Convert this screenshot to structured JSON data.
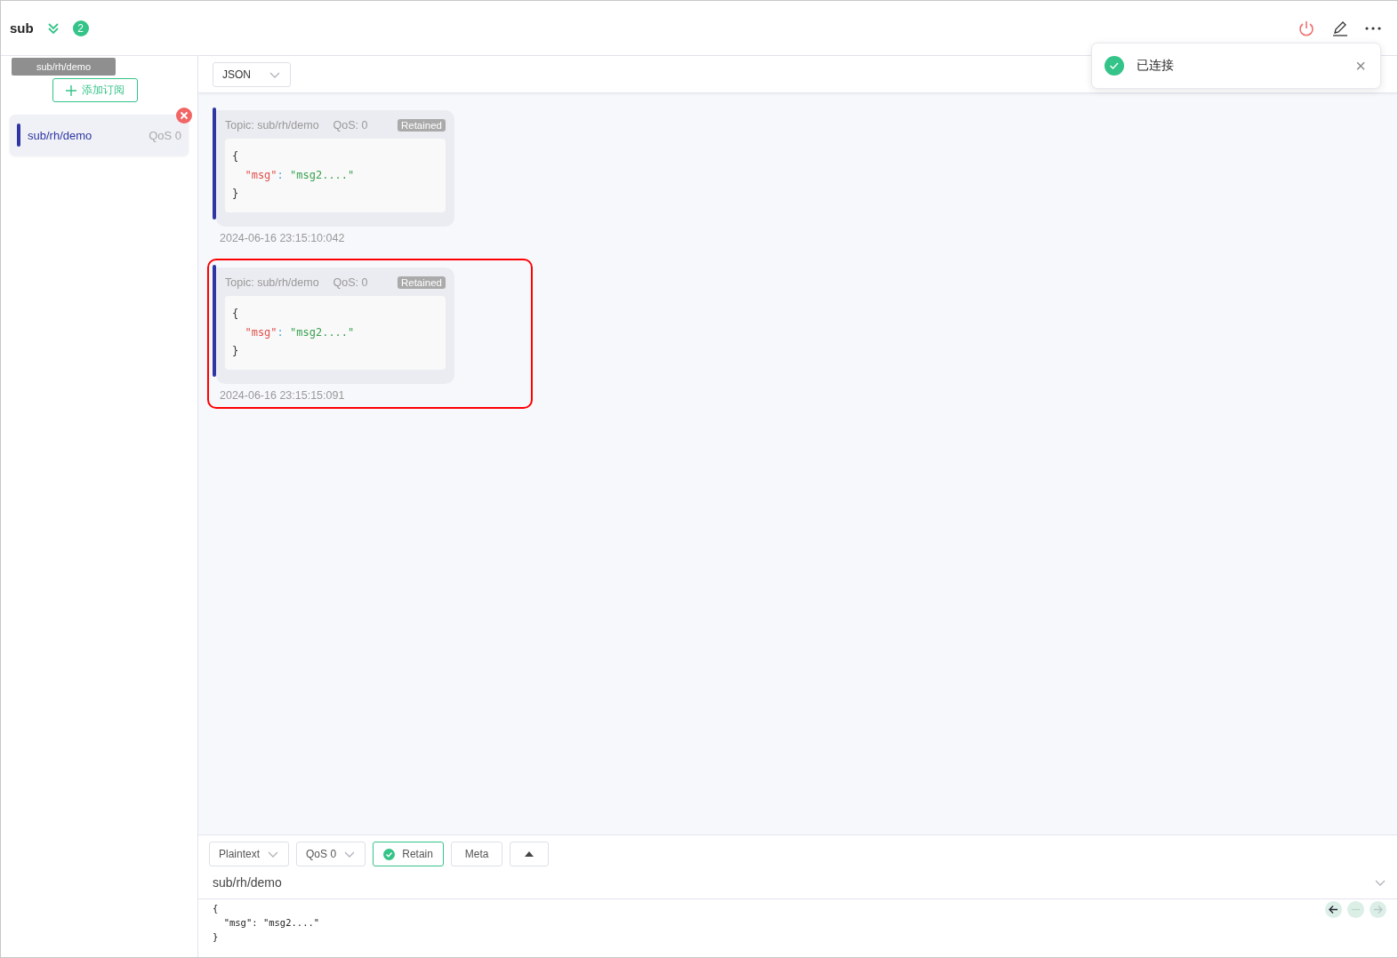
{
  "header": {
    "title": "sub",
    "unread_count": "2"
  },
  "toast": {
    "text": "已连接",
    "close": "×"
  },
  "sidebar": {
    "tooltip": "sub/rh/demo",
    "add_button": "添加订阅",
    "subscriptions": [
      {
        "topic": "sub/rh/demo",
        "qos": "QoS 0",
        "color": "#2f36a3"
      }
    ]
  },
  "toolbar": {
    "format": "JSON"
  },
  "messages": [
    {
      "topic": "Topic: sub/rh/demo",
      "qos": "QoS: 0",
      "badge": "Retained",
      "payload": [
        "{",
        "  \"msg\": \"msg2....\"",
        "}"
      ],
      "time": "2024-06-16 23:15:10:042",
      "highlighted": false
    },
    {
      "topic": "Topic: sub/rh/demo",
      "qos": "QoS: 0",
      "badge": "Retained",
      "payload": [
        "{",
        "  \"msg\": \"msg2....\"",
        "}"
      ],
      "time": "2024-06-16 23:15:15:091",
      "highlighted": true
    }
  ],
  "composer": {
    "format": "Plaintext",
    "qos": "QoS 0",
    "retain": {
      "label": "Retain",
      "checked": true
    },
    "meta": "Meta",
    "topic": "sub/rh/demo",
    "payload": [
      "{",
      "  \"msg\": \"msg2....\"",
      "}"
    ]
  }
}
